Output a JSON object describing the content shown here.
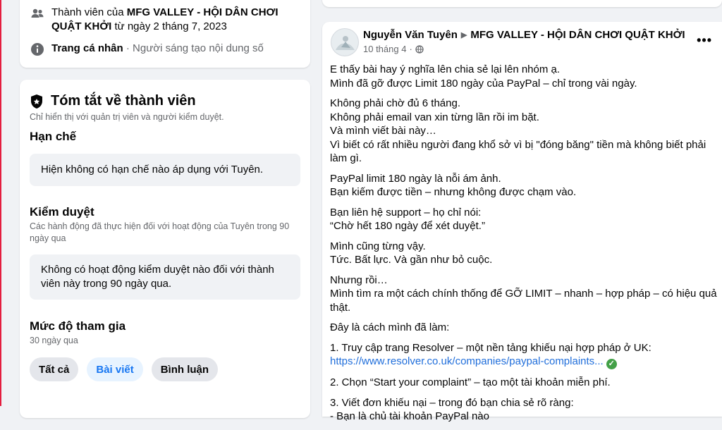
{
  "membership": {
    "member_prefix": "Thành viên của ",
    "group_name": "MFG VALLEY - HỘI DÂN CHƠI QUẬT KHỞI",
    "member_since": " từ ngày 2 tháng 7, 2023",
    "profile_label": "Trang cá nhân",
    "profile_sep": " · ",
    "profile_desc": "Người sáng tạo nội dung số"
  },
  "summary": {
    "title": "Tóm tắt về thành viên",
    "visibility": "Chỉ hiển thị với quản trị viên và người kiểm duyệt.",
    "restrictions_heading": "Hạn chế",
    "restrictions_text": "Hiện không có hạn chế nào áp dụng với Tuyên.",
    "moderation_heading": "Kiểm duyệt",
    "moderation_sub": "Các hành động đã thực hiện đối với hoạt động của Tuyên trong 90 ngày qua",
    "moderation_text": "Không có hoạt động kiểm duyệt nào đối với thành viên này trong 90 ngày qua.",
    "engagement_heading": "Mức độ tham gia",
    "engagement_sub": "30 ngày qua",
    "tabs": [
      {
        "label": "Tất cả"
      },
      {
        "label": "Bài viết"
      },
      {
        "label": "Bình luận"
      }
    ]
  },
  "post": {
    "author": "Nguyễn Văn Tuyên",
    "group": "MFG VALLEY - HỘI DÂN CHƠI QUẬT KHỞI",
    "date": "10 tháng 4",
    "more": "•••",
    "paragraphs": [
      [
        "E thấy bài hay ý nghĩa lên chia sẻ lại lên nhóm ạ.",
        "Mình đã gỡ được Limit 180 ngày của PayPal – chỉ trong vài ngày."
      ],
      [
        "Không phải chờ đủ 6 tháng.",
        "Không phải email van xin từng lần rồi im bặt.",
        "Và mình viết bài này…",
        "Vì biết có rất nhiều người đang khổ sở vì bị \"đóng băng\" tiền mà không biết phải làm gì."
      ],
      [
        "PayPal limit 180 ngày là nỗi ám ảnh.",
        "Bạn kiếm được tiền – nhưng không được chạm vào."
      ],
      [
        "Bạn liên hệ support – họ chỉ nói:",
        "“Chờ hết 180 ngày để xét duyệt.”"
      ],
      [
        "Mình cũng từng vậy.",
        "Tức. Bất lực. Và gần như bỏ cuộc."
      ],
      [
        "Nhưng rồi…",
        "Mình tìm ra một cách chính thống để GỠ LIMIT – nhanh – hợp pháp – có hiệu quả thật."
      ],
      [
        " Đây là cách mình đã làm:"
      ]
    ],
    "step1": "1. Truy cập trang Resolver – một nền tảng khiếu nại hợp pháp ở UK:",
    "link": "https://www.resolver.co.uk/companies/paypal-complaints...",
    "step2": "2. Chọn “Start your complaint” – tạo một tài khoản miễn phí.",
    "step3": "3. Viết đơn khiếu nại – trong đó bạn chia sẻ rõ ràng:",
    "step3_cut": "- Bạn là chủ tài khoản PayPal nào"
  }
}
